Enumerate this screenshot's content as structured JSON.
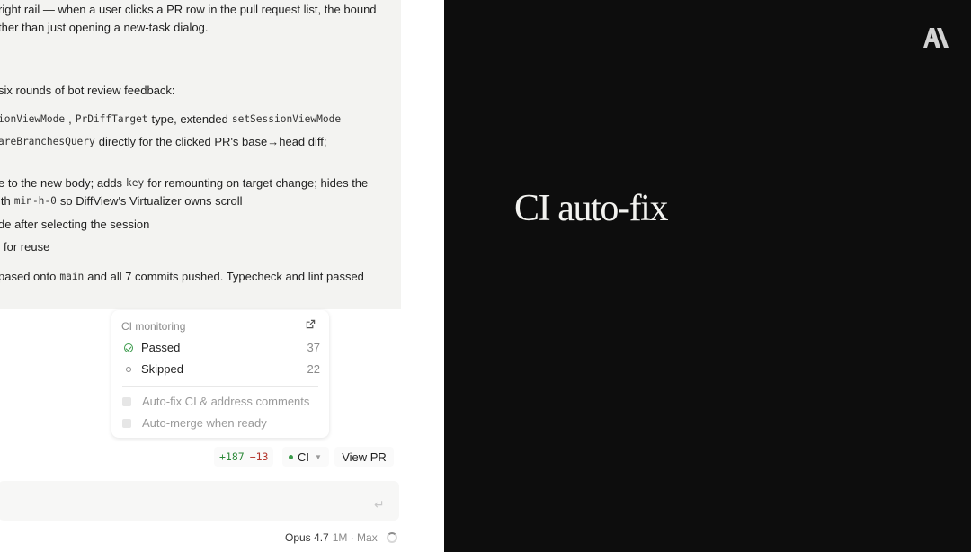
{
  "message": {
    "line1": "right rail — when a user clicks a PR row in the pull request list, the bound",
    "line2": "ther than just opening a new-task dialog.",
    "line3": "six rounds of bot review feedback:",
    "line4": {
      "code1": "ionViewMode",
      "sep1": ",",
      "code2": "PrDiffTarget",
      "text1": "type, extended",
      "code3": "setSessionViewMode"
    },
    "line5": {
      "code1": "areBranchesQuery",
      "text1": "directly for the clicked PR's base→head diff;"
    },
    "line6": {
      "text1": "e to the new body; adds",
      "code1": "key",
      "text2": "for remounting on target change; hides the"
    },
    "line7": {
      "text1": "ith",
      "code1": "min-h-0",
      "text2": "so DiffView's Virtualizer owns scroll"
    },
    "line8": "de after selecting the session",
    "line9": "for reuse",
    "line10": {
      "text1": "pased onto",
      "code1": "main",
      "text2": "and all 7 commits pushed. Typecheck and lint passed"
    }
  },
  "ci_monitoring": {
    "header": "CI monitoring",
    "external_icon": "external-link-icon",
    "rows": [
      {
        "label": "Passed",
        "count": "37",
        "icon": "check-circle-icon",
        "color": "#3a9a4a"
      },
      {
        "label": "Skipped",
        "count": "22",
        "icon": "circle-outline-icon",
        "color": "#8a8a8a"
      }
    ],
    "options": [
      {
        "label": "Auto-fix CI & address comments",
        "checked": false
      },
      {
        "label": "Auto-merge when ready",
        "checked": false
      }
    ]
  },
  "toolbar": {
    "additions": "+187",
    "deletions": "−13",
    "ci_label": "CI",
    "view_pr_label": "View PR"
  },
  "composer": {
    "enter_icon": "enter-icon"
  },
  "model": {
    "name": "Opus 4.7",
    "meta": "1M · Max"
  },
  "slide": {
    "title": "CI auto-fix"
  },
  "colors": {
    "pass": "#3a9a4a",
    "additions": "#2e8a3a",
    "deletions": "#b3352c",
    "slide_bg": "#0d0d0d",
    "slide_text": "#f2f2ef"
  }
}
